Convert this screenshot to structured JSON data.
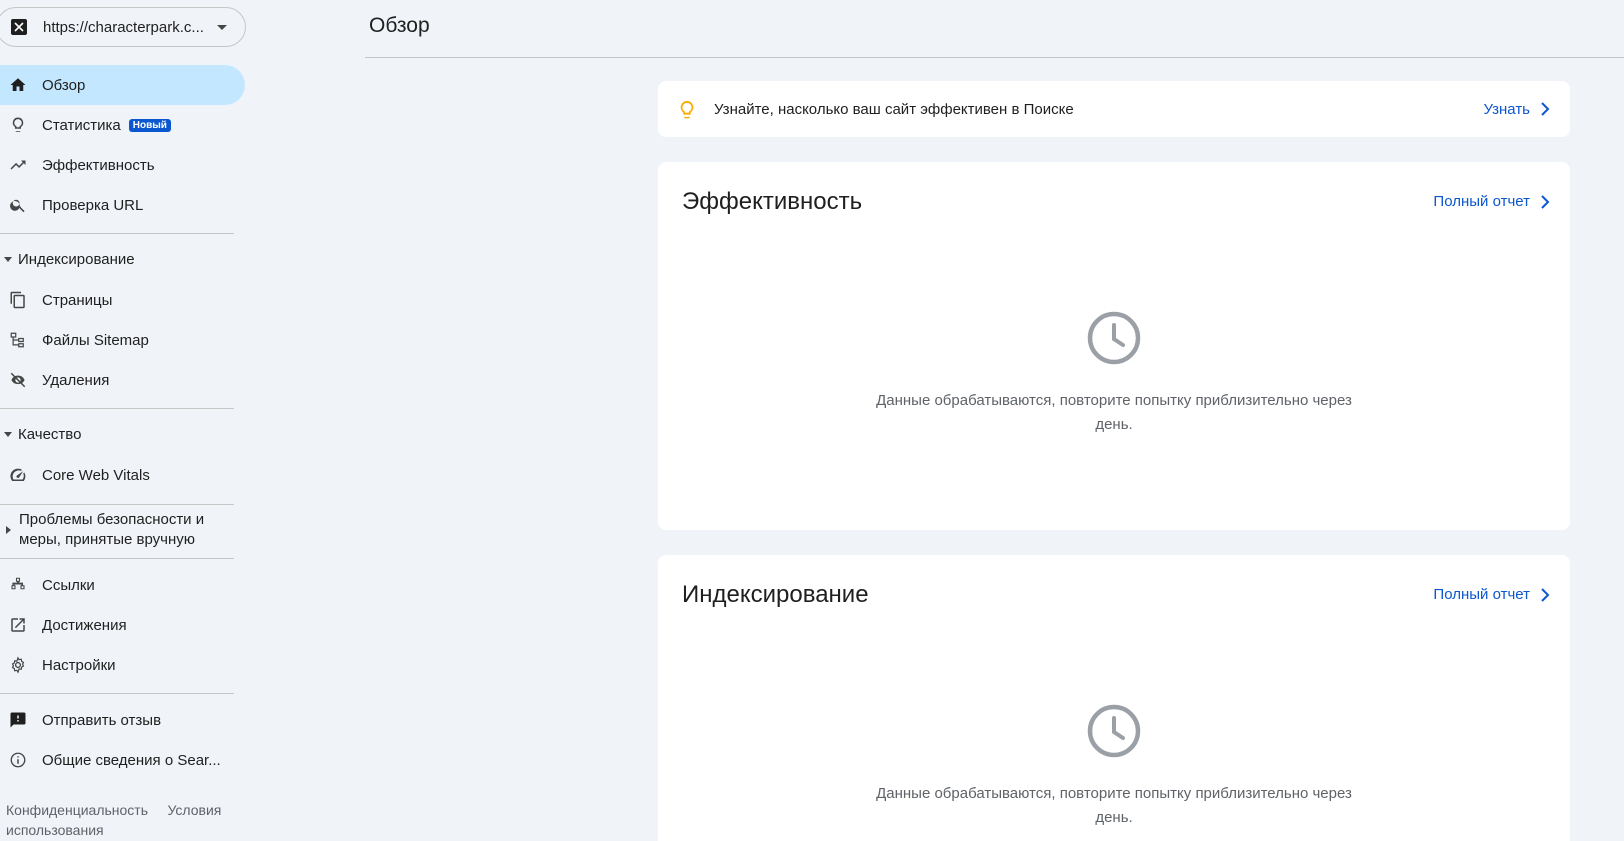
{
  "property": {
    "url": "https://characterpark.c..."
  },
  "sidebar": {
    "items_top": [
      {
        "label": "Обзор",
        "icon": "home-icon"
      },
      {
        "label": "Статистика",
        "icon": "lightbulb-icon",
        "badge": "Новый"
      },
      {
        "label": "Эффективность",
        "icon": "trending-up-icon"
      },
      {
        "label": "Проверка URL",
        "icon": "search-icon"
      }
    ],
    "indexing": {
      "header": "Индексирование",
      "items": [
        {
          "label": "Страницы",
          "icon": "pages-icon"
        },
        {
          "label": "Файлы Sitemap",
          "icon": "sitemap-icon"
        },
        {
          "label": "Удаления",
          "icon": "eye-off-icon"
        }
      ]
    },
    "quality": {
      "header": "Качество",
      "items": [
        {
          "label": "Core Web Vitals",
          "icon": "speedometer-icon"
        }
      ]
    },
    "security": {
      "header": "Проблемы безопасности и меры, принятые вручную"
    },
    "items_bottom": [
      {
        "label": "Ссылки",
        "icon": "links-icon"
      },
      {
        "label": "Достижения",
        "icon": "open-external-icon"
      },
      {
        "label": "Настройки",
        "icon": "gear-icon"
      }
    ],
    "items_extra": [
      {
        "label": "Отправить отзыв",
        "icon": "feedback-icon"
      },
      {
        "label": "Общие сведения о Sear...",
        "icon": "info-icon"
      }
    ],
    "footer": {
      "privacy": "Конфиденциальность",
      "terms": "Условия использования"
    }
  },
  "header": {
    "title": "Обзор"
  },
  "insight": {
    "text": "Узнайте, насколько ваш сайт эффективен в Поиске",
    "link": "Узнать"
  },
  "cards": [
    {
      "title": "Эффективность",
      "link": "Полный отчет",
      "message": "Данные обрабатываются, повторите попытку приблизительно через день."
    },
    {
      "title": "Индексирование",
      "link": "Полный отчет",
      "message": "Данные обрабатываются, повторите попытку приблизительно через день."
    }
  ],
  "colors": {
    "accent": "#0b57d0",
    "active_bg": "#c2e7ff",
    "page_bg": "#f0f4f9",
    "insight_bulb": "#f9ab00"
  }
}
